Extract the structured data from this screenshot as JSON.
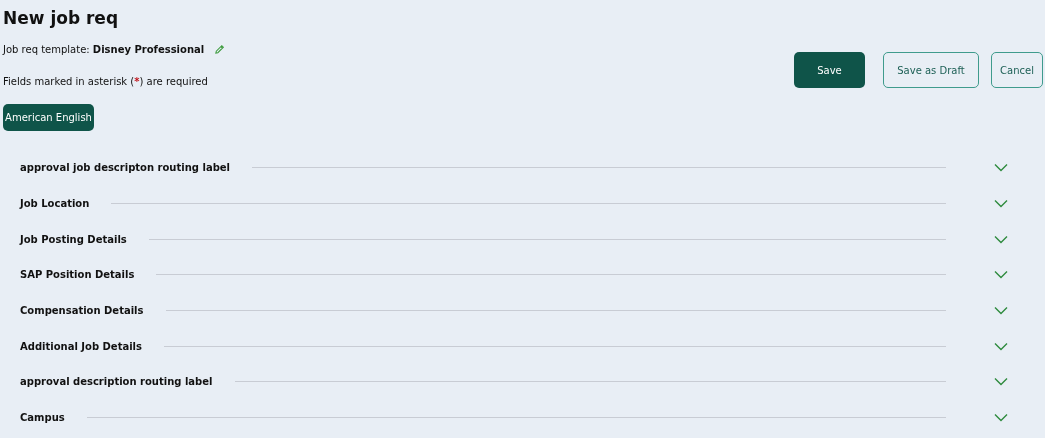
{
  "title": "New job req",
  "template": {
    "text": "Job req template: **Disney Professional**"
  },
  "required_note": {
    "before": "Fields marked in asterisk (",
    "mark": "*",
    "after": ") are required"
  },
  "language": "American English",
  "buttons": [
    {
      "label": "Save",
      "kind": "primary"
    },
    {
      "label": "Save as Draft",
      "kind": "outline"
    },
    {
      "label": "Cancel",
      "kind": "outline"
    }
  ],
  "sections": [
    {
      "label": "approval job descripton routing label",
      "expanded": false
    },
    {
      "label": "Job Location",
      "expanded": false
    },
    {
      "label": "Job Posting Details",
      "expanded": false
    },
    {
      "label": "SAP Position Details",
      "expanded": false
    },
    {
      "label": "Compensation Details",
      "expanded": false
    },
    {
      "label": "Additional Job Details",
      "expanded": false
    },
    {
      "label": "approval description routing label",
      "expanded": false
    },
    {
      "label": "Campus",
      "expanded": false
    }
  ]
}
